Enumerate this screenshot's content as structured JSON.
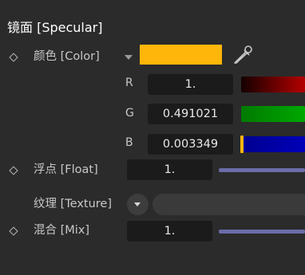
{
  "section": {
    "title": "镜面 [Specular]"
  },
  "color": {
    "label": "颜色 [Color]",
    "swatch_color": "#ffb60a",
    "channels": [
      {
        "letter": "R",
        "value": "1."
      },
      {
        "letter": "G",
        "value": "0.491021"
      },
      {
        "letter": "B",
        "value": "0.003349"
      }
    ],
    "channel_levels": [
      1.0,
      0.491021,
      0.003349
    ]
  },
  "float": {
    "label": "浮点 [Float]",
    "value": "1."
  },
  "texture": {
    "label": "纹理 [Texture]"
  },
  "mix": {
    "label": "混合 [Mix]",
    "value": "1."
  },
  "colors": {
    "background": "#2b2b2b",
    "field_bg": "#1b1b1b",
    "slider_track": "#6b6ba8",
    "channel_marker": "#ffb60a"
  }
}
